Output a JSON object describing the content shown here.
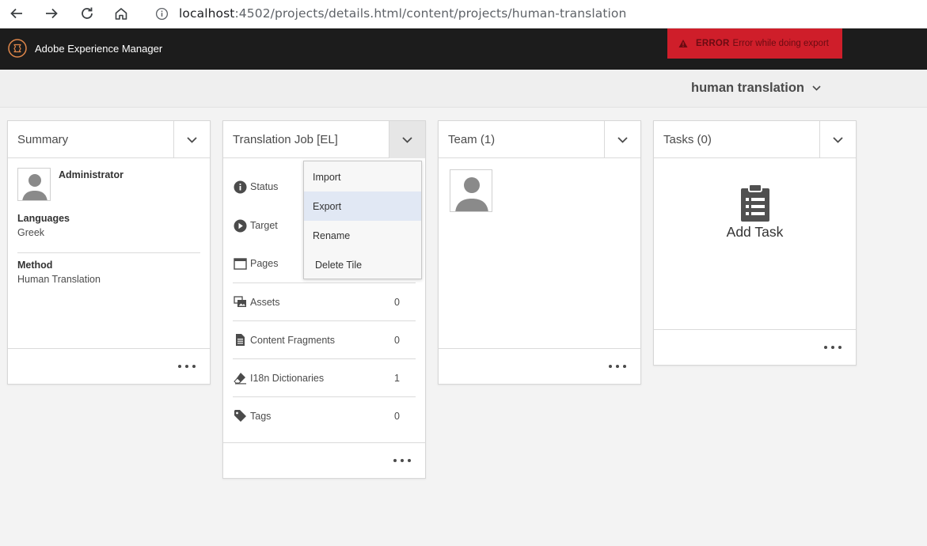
{
  "browser": {
    "url_host": "localhost",
    "url_path": ":4502/projects/details.html/content/projects/human-translation"
  },
  "header": {
    "app_title": "Adobe Experience Manager"
  },
  "toast": {
    "label": "ERROR",
    "message": "Error while doing export",
    "color": "#cf1e2a"
  },
  "project": {
    "title": "human translation"
  },
  "summary": {
    "title": "Summary",
    "owner": "Administrator",
    "languages_label": "Languages",
    "languages_value": "Greek",
    "method_label": "Method",
    "method_value": "Human Translation"
  },
  "job": {
    "title": "Translation Job [EL]",
    "rows": [
      {
        "label": "Status",
        "icon": "info-icon",
        "count": ""
      },
      {
        "label": "Target",
        "icon": "play-icon",
        "count": ""
      },
      {
        "label": "Pages",
        "icon": "page-icon",
        "count": ""
      },
      {
        "label": "Assets",
        "icon": "assets-icon",
        "count": "0"
      },
      {
        "label": "Content Fragments",
        "icon": "document-icon",
        "count": "0"
      },
      {
        "label": "I18n Dictionaries",
        "icon": "eraser-icon",
        "count": "1"
      },
      {
        "label": "Tags",
        "icon": "tag-icon",
        "count": "0"
      }
    ]
  },
  "menu": {
    "items": [
      {
        "label": "Import"
      },
      {
        "label": "Export",
        "highlighted": true
      },
      {
        "label": "Rename"
      },
      {
        "label": "Delete Tile"
      }
    ]
  },
  "team": {
    "title": "Team (1)"
  },
  "tasks": {
    "title": "Tasks (0)",
    "add_label": "Add Task"
  }
}
